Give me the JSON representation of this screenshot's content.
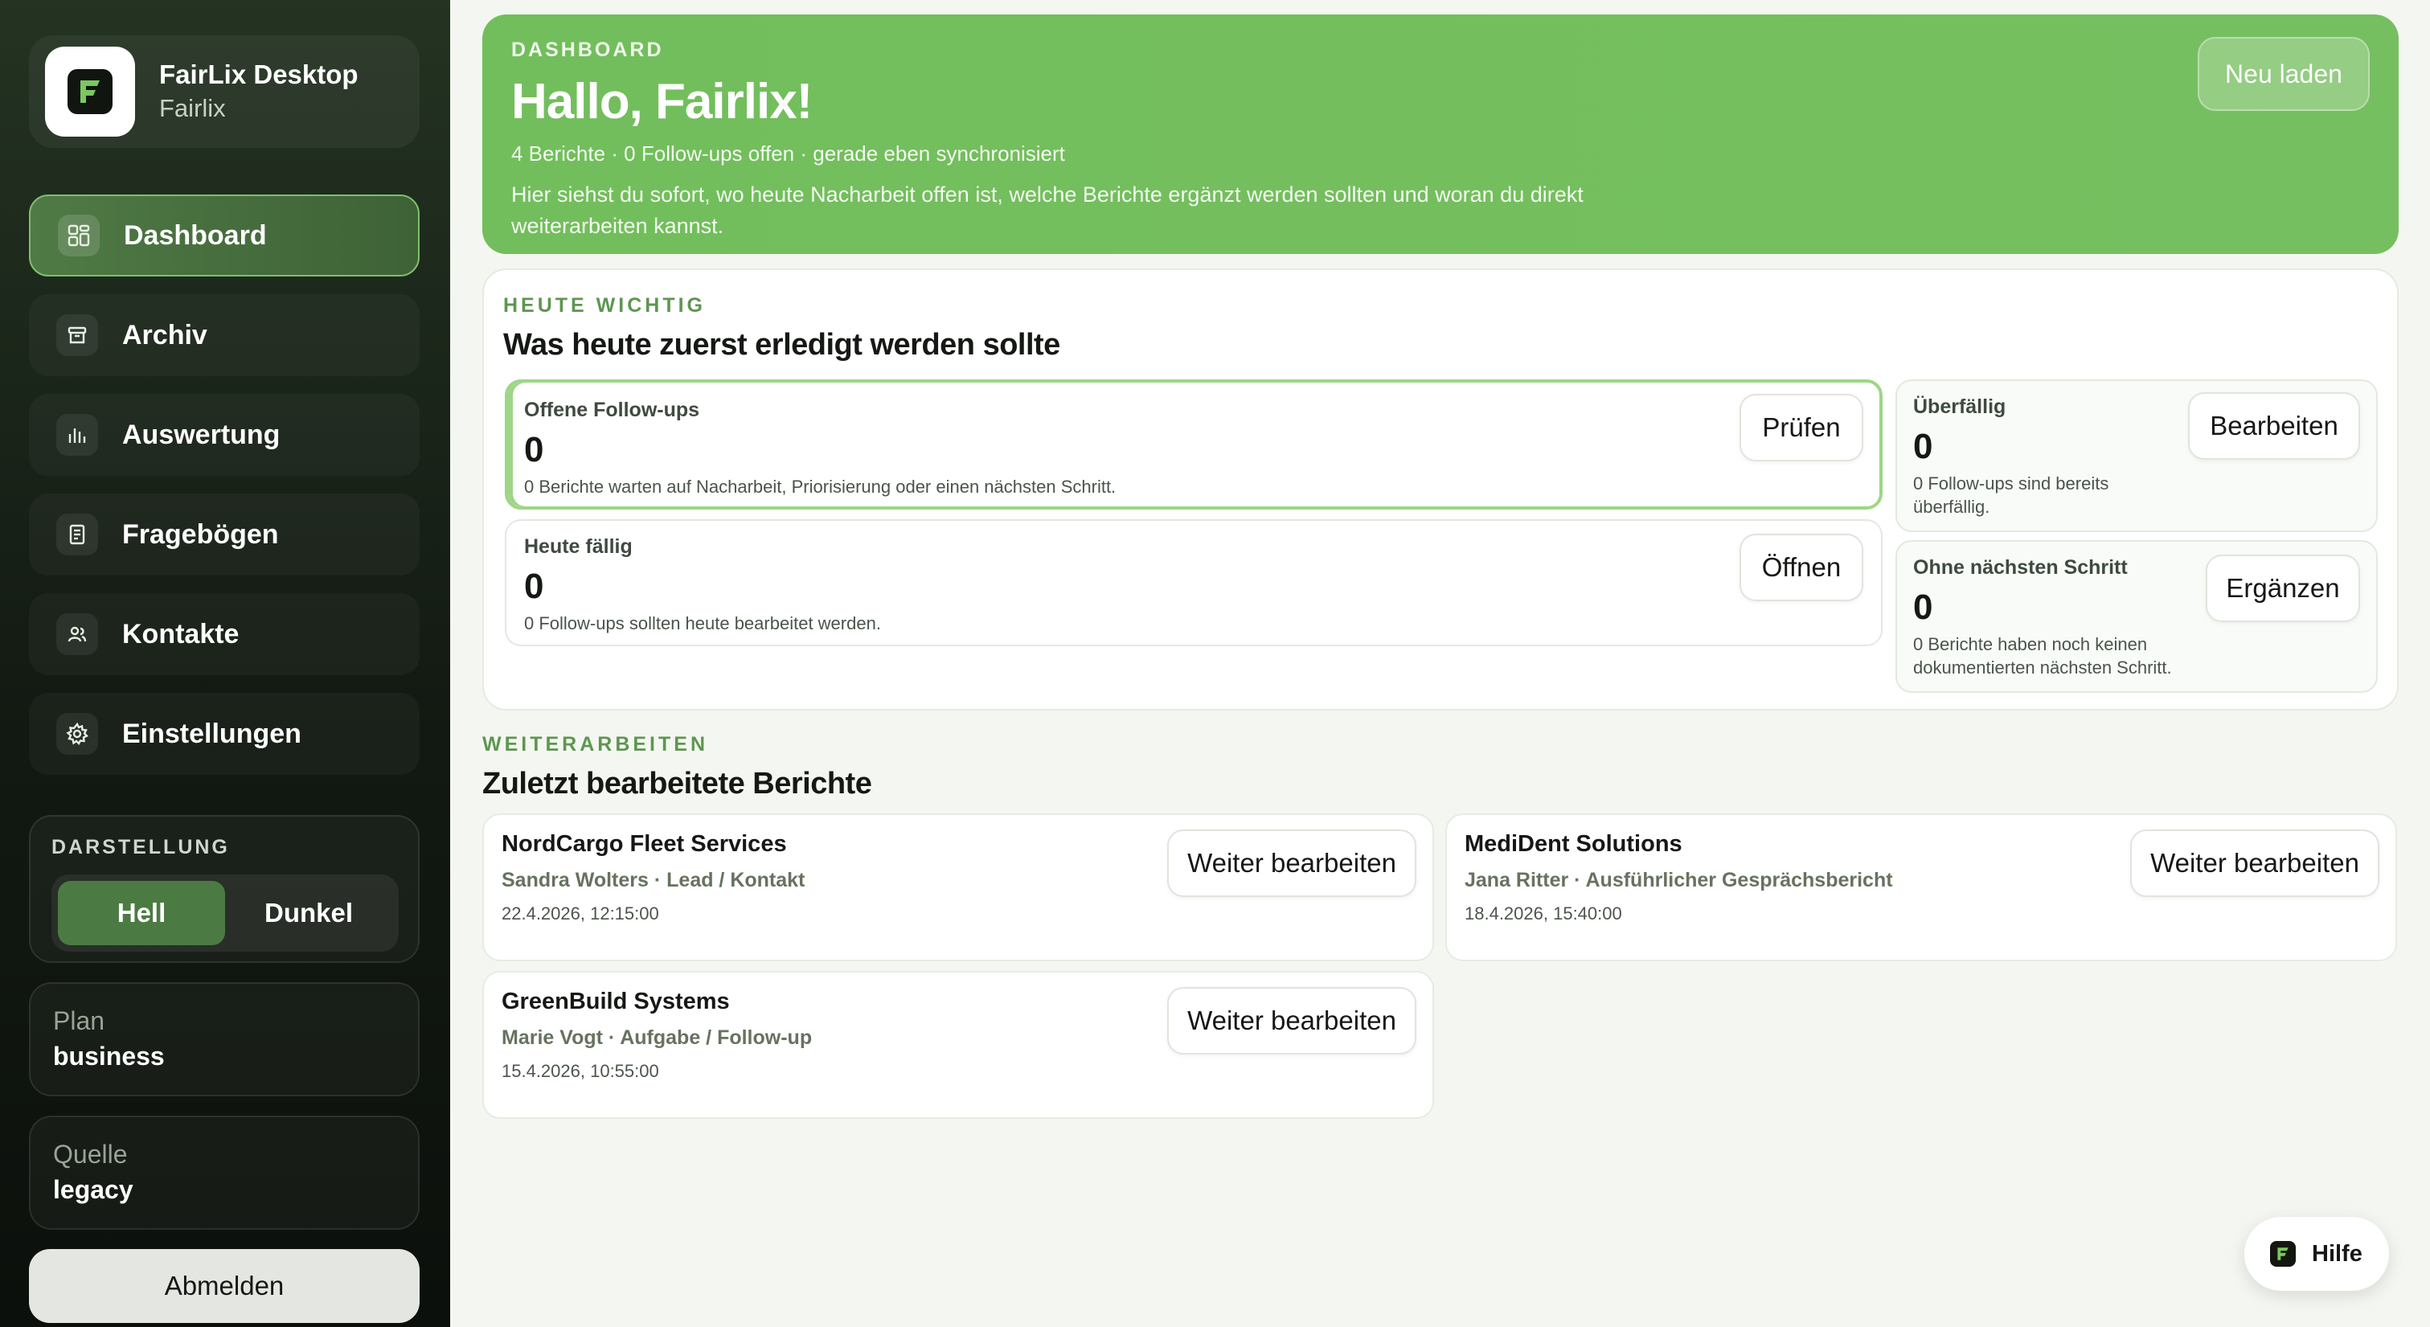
{
  "app": {
    "title": "FairLix Desktop",
    "subtitle": "Fairlix"
  },
  "sidebar": {
    "items": [
      {
        "label": "Dashboard",
        "icon": "dashboard-grid-icon",
        "active": true
      },
      {
        "label": "Archiv",
        "icon": "archive-box-icon",
        "active": false
      },
      {
        "label": "Auswertung",
        "icon": "bar-chart-icon",
        "active": false
      },
      {
        "label": "Fragebögen",
        "icon": "document-list-icon",
        "active": false
      },
      {
        "label": "Kontakte",
        "icon": "contacts-icon",
        "active": false
      },
      {
        "label": "Einstellungen",
        "icon": "gear-icon",
        "active": false
      }
    ],
    "theme": {
      "caption": "DARSTELLUNG",
      "light": "Hell",
      "dark": "Dunkel",
      "selected": "Hell"
    },
    "plan": {
      "label": "Plan",
      "value": "business"
    },
    "source": {
      "label": "Quelle",
      "value": "legacy"
    },
    "logout_label": "Abmelden"
  },
  "hero": {
    "kicker": "DASHBOARD",
    "title": "Hallo, Fairlix!",
    "meta": "4 Berichte · 0 Follow-ups offen · gerade eben synchronisiert",
    "description": "Hier siehst du sofort, wo heute Nacharbeit offen ist, welche Berichte ergänzt werden sollten und woran du direkt weiterarbeiten kannst.",
    "reload_label": "Neu laden"
  },
  "today": {
    "kicker": "HEUTE WICHTIG",
    "title": "Was heute zuerst erledigt werden sollte",
    "cards": {
      "open_followups": {
        "label": "Offene Follow-ups",
        "value": "0",
        "note": "0 Berichte warten auf Nacharbeit, Priorisierung oder einen nächsten Schritt.",
        "button": "Prüfen"
      },
      "due_today": {
        "label": "Heute fällig",
        "value": "0",
        "note": "0 Follow-ups sollten heute bearbeitet werden.",
        "button": "Öffnen"
      },
      "overdue": {
        "label": "Überfällig",
        "value": "0",
        "note": "0 Follow-ups sind bereits überfällig.",
        "button": "Bearbeiten"
      },
      "no_next_step": {
        "label": "Ohne nächsten Schritt",
        "value": "0",
        "note": "0 Berichte haben noch keinen dokumentierten nächsten Schritt.",
        "button": "Ergänzen"
      }
    }
  },
  "continue": {
    "kicker": "WEITERARBEITEN",
    "title": "Zuletzt bearbeitete Berichte",
    "reports": [
      {
        "company": "NordCargo Fleet Services",
        "person": "Sandra Wolters · Lead / Kontakt",
        "date": "22.4.2026, 12:15:00",
        "button": "Weiter bearbeiten"
      },
      {
        "company": "MediDent Solutions",
        "person": "Jana Ritter · Ausführlicher Gesprächsbericht",
        "date": "18.4.2026, 15:40:00",
        "button": "Weiter bearbeiten"
      },
      {
        "company": "GreenBuild Systems",
        "person": "Marie Vogt · Aufgabe / Follow-up",
        "date": "15.4.2026, 10:55:00",
        "button": "Weiter bearbeiten"
      }
    ]
  },
  "help": {
    "label": "Hilfe"
  },
  "colors": {
    "accent": "#74be5e",
    "sidebar_bg": "#121912",
    "active_nav": "#4f7a45"
  }
}
